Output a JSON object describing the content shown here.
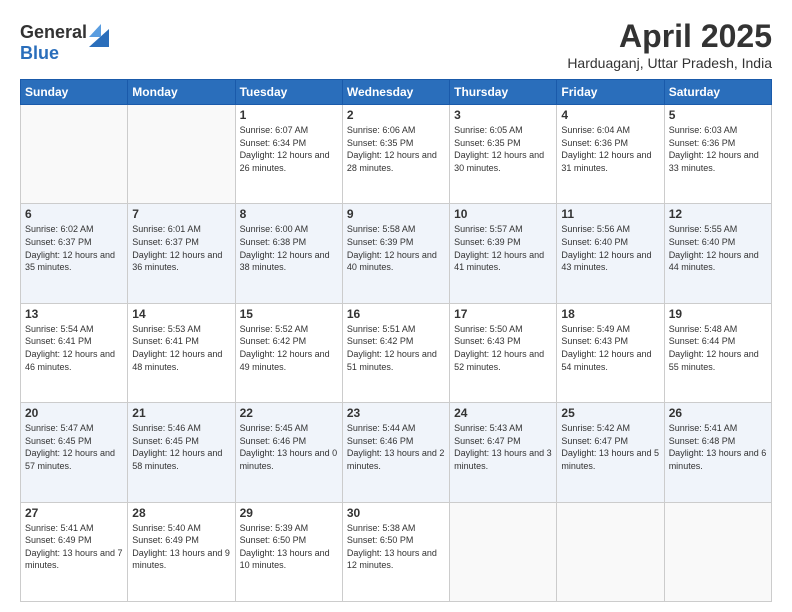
{
  "logo": {
    "general": "General",
    "blue": "Blue"
  },
  "title": "April 2025",
  "subtitle": "Harduaganj, Uttar Pradesh, India",
  "days_of_week": [
    "Sunday",
    "Monday",
    "Tuesday",
    "Wednesday",
    "Thursday",
    "Friday",
    "Saturday"
  ],
  "weeks": [
    [
      {
        "day": "",
        "sunrise": "",
        "sunset": "",
        "daylight": ""
      },
      {
        "day": "",
        "sunrise": "",
        "sunset": "",
        "daylight": ""
      },
      {
        "day": "1",
        "sunrise": "Sunrise: 6:07 AM",
        "sunset": "Sunset: 6:34 PM",
        "daylight": "Daylight: 12 hours and 26 minutes."
      },
      {
        "day": "2",
        "sunrise": "Sunrise: 6:06 AM",
        "sunset": "Sunset: 6:35 PM",
        "daylight": "Daylight: 12 hours and 28 minutes."
      },
      {
        "day": "3",
        "sunrise": "Sunrise: 6:05 AM",
        "sunset": "Sunset: 6:35 PM",
        "daylight": "Daylight: 12 hours and 30 minutes."
      },
      {
        "day": "4",
        "sunrise": "Sunrise: 6:04 AM",
        "sunset": "Sunset: 6:36 PM",
        "daylight": "Daylight: 12 hours and 31 minutes."
      },
      {
        "day": "5",
        "sunrise": "Sunrise: 6:03 AM",
        "sunset": "Sunset: 6:36 PM",
        "daylight": "Daylight: 12 hours and 33 minutes."
      }
    ],
    [
      {
        "day": "6",
        "sunrise": "Sunrise: 6:02 AM",
        "sunset": "Sunset: 6:37 PM",
        "daylight": "Daylight: 12 hours and 35 minutes."
      },
      {
        "day": "7",
        "sunrise": "Sunrise: 6:01 AM",
        "sunset": "Sunset: 6:37 PM",
        "daylight": "Daylight: 12 hours and 36 minutes."
      },
      {
        "day": "8",
        "sunrise": "Sunrise: 6:00 AM",
        "sunset": "Sunset: 6:38 PM",
        "daylight": "Daylight: 12 hours and 38 minutes."
      },
      {
        "day": "9",
        "sunrise": "Sunrise: 5:58 AM",
        "sunset": "Sunset: 6:39 PM",
        "daylight": "Daylight: 12 hours and 40 minutes."
      },
      {
        "day": "10",
        "sunrise": "Sunrise: 5:57 AM",
        "sunset": "Sunset: 6:39 PM",
        "daylight": "Daylight: 12 hours and 41 minutes."
      },
      {
        "day": "11",
        "sunrise": "Sunrise: 5:56 AM",
        "sunset": "Sunset: 6:40 PM",
        "daylight": "Daylight: 12 hours and 43 minutes."
      },
      {
        "day": "12",
        "sunrise": "Sunrise: 5:55 AM",
        "sunset": "Sunset: 6:40 PM",
        "daylight": "Daylight: 12 hours and 44 minutes."
      }
    ],
    [
      {
        "day": "13",
        "sunrise": "Sunrise: 5:54 AM",
        "sunset": "Sunset: 6:41 PM",
        "daylight": "Daylight: 12 hours and 46 minutes."
      },
      {
        "day": "14",
        "sunrise": "Sunrise: 5:53 AM",
        "sunset": "Sunset: 6:41 PM",
        "daylight": "Daylight: 12 hours and 48 minutes."
      },
      {
        "day": "15",
        "sunrise": "Sunrise: 5:52 AM",
        "sunset": "Sunset: 6:42 PM",
        "daylight": "Daylight: 12 hours and 49 minutes."
      },
      {
        "day": "16",
        "sunrise": "Sunrise: 5:51 AM",
        "sunset": "Sunset: 6:42 PM",
        "daylight": "Daylight: 12 hours and 51 minutes."
      },
      {
        "day": "17",
        "sunrise": "Sunrise: 5:50 AM",
        "sunset": "Sunset: 6:43 PM",
        "daylight": "Daylight: 12 hours and 52 minutes."
      },
      {
        "day": "18",
        "sunrise": "Sunrise: 5:49 AM",
        "sunset": "Sunset: 6:43 PM",
        "daylight": "Daylight: 12 hours and 54 minutes."
      },
      {
        "day": "19",
        "sunrise": "Sunrise: 5:48 AM",
        "sunset": "Sunset: 6:44 PM",
        "daylight": "Daylight: 12 hours and 55 minutes."
      }
    ],
    [
      {
        "day": "20",
        "sunrise": "Sunrise: 5:47 AM",
        "sunset": "Sunset: 6:45 PM",
        "daylight": "Daylight: 12 hours and 57 minutes."
      },
      {
        "day": "21",
        "sunrise": "Sunrise: 5:46 AM",
        "sunset": "Sunset: 6:45 PM",
        "daylight": "Daylight: 12 hours and 58 minutes."
      },
      {
        "day": "22",
        "sunrise": "Sunrise: 5:45 AM",
        "sunset": "Sunset: 6:46 PM",
        "daylight": "Daylight: 13 hours and 0 minutes."
      },
      {
        "day": "23",
        "sunrise": "Sunrise: 5:44 AM",
        "sunset": "Sunset: 6:46 PM",
        "daylight": "Daylight: 13 hours and 2 minutes."
      },
      {
        "day": "24",
        "sunrise": "Sunrise: 5:43 AM",
        "sunset": "Sunset: 6:47 PM",
        "daylight": "Daylight: 13 hours and 3 minutes."
      },
      {
        "day": "25",
        "sunrise": "Sunrise: 5:42 AM",
        "sunset": "Sunset: 6:47 PM",
        "daylight": "Daylight: 13 hours and 5 minutes."
      },
      {
        "day": "26",
        "sunrise": "Sunrise: 5:41 AM",
        "sunset": "Sunset: 6:48 PM",
        "daylight": "Daylight: 13 hours and 6 minutes."
      }
    ],
    [
      {
        "day": "27",
        "sunrise": "Sunrise: 5:41 AM",
        "sunset": "Sunset: 6:49 PM",
        "daylight": "Daylight: 13 hours and 7 minutes."
      },
      {
        "day": "28",
        "sunrise": "Sunrise: 5:40 AM",
        "sunset": "Sunset: 6:49 PM",
        "daylight": "Daylight: 13 hours and 9 minutes."
      },
      {
        "day": "29",
        "sunrise": "Sunrise: 5:39 AM",
        "sunset": "Sunset: 6:50 PM",
        "daylight": "Daylight: 13 hours and 10 minutes."
      },
      {
        "day": "30",
        "sunrise": "Sunrise: 5:38 AM",
        "sunset": "Sunset: 6:50 PM",
        "daylight": "Daylight: 13 hours and 12 minutes."
      },
      {
        "day": "",
        "sunrise": "",
        "sunset": "",
        "daylight": ""
      },
      {
        "day": "",
        "sunrise": "",
        "sunset": "",
        "daylight": ""
      },
      {
        "day": "",
        "sunrise": "",
        "sunset": "",
        "daylight": ""
      }
    ]
  ]
}
